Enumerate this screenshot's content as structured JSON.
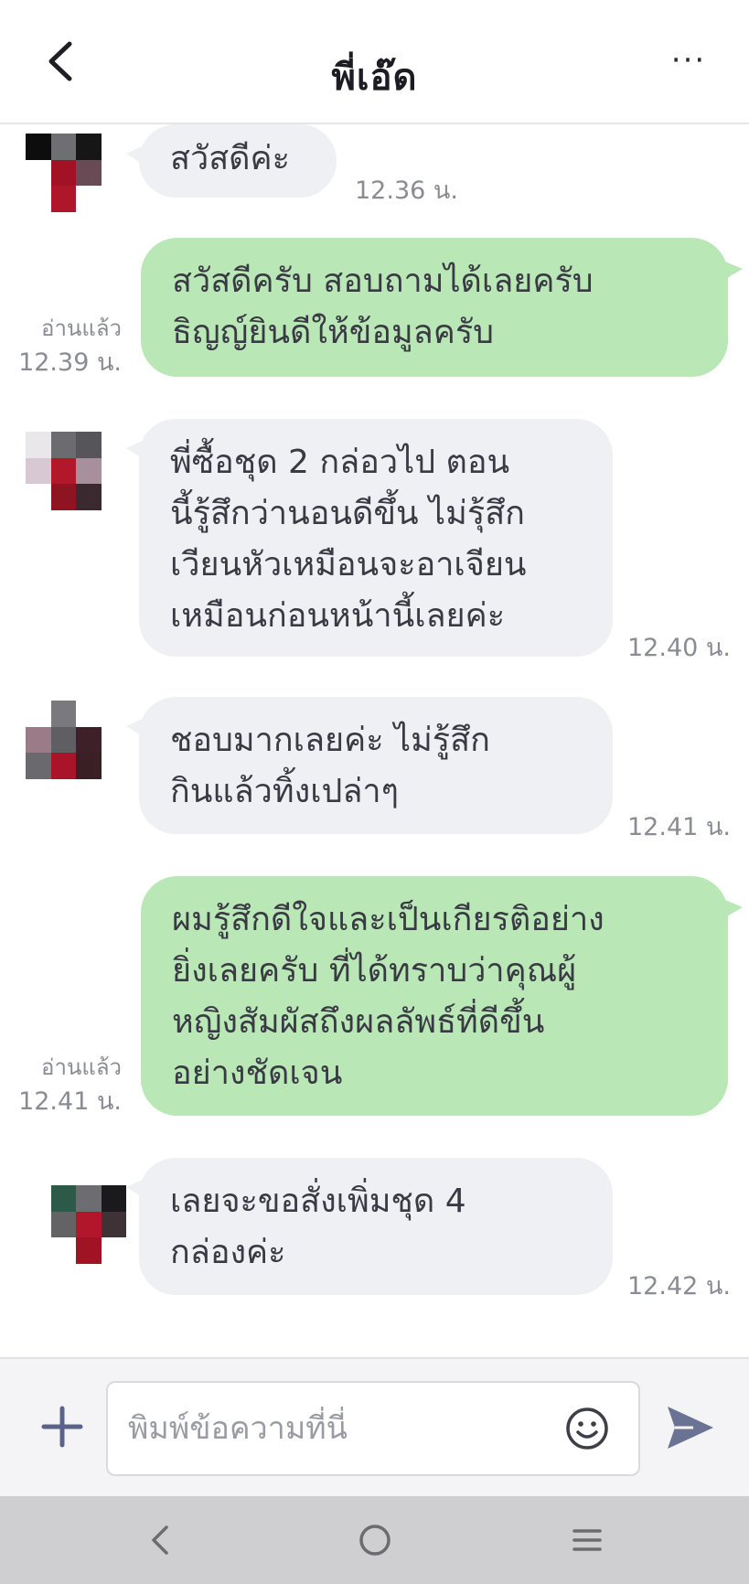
{
  "header": {
    "title": "พี่เอ๊ด",
    "back_icon": "chevron-left-icon",
    "more_icon": "more-dots-icon",
    "more_label": "···"
  },
  "messages": [
    {
      "side": "in",
      "lines": [
        "สวัสดีค่ะ"
      ],
      "time": "12.36 น."
    },
    {
      "side": "out",
      "lines": [
        "สวัสดีครับ สอบถามได้เลยครับ",
        "ธิญญ์ยินดีให้ข้อมูลครับ"
      ],
      "read": "อ่านแล้ว",
      "time": "12.39 น."
    },
    {
      "side": "in",
      "lines": [
        "พี่ซื้อชุด 2 กล่อวไป ตอน",
        "นี้รู้สึกว่านอนดีขึ้น ไม่รุ้สึก",
        "เวียนหัวเหมือนจะอาเจียน",
        "เหมือนก่อนหน้านี้เลยค่ะ"
      ],
      "time": "12.40 น."
    },
    {
      "side": "in",
      "lines": [
        "ชอบมากเลยค่ะ ไม่รู้สึก",
        "กินแล้วทิ้งเปล่าๆ"
      ],
      "time": "12.41 น."
    },
    {
      "side": "out",
      "lines": [
        "ผมรู้สึกดีใจและเป็นเกียรติอย่าง",
        "ยิ่งเลยครับ ที่ได้ทราบว่าคุณผู้",
        "หญิงสัมผัสถึงผลลัพธ์ที่ดีขึ้น",
        "อย่างชัดเจน"
      ],
      "read": "อ่านแล้ว",
      "time": "12.41 น."
    },
    {
      "side": "in",
      "lines": [
        "เลยจะขอสั่งเพิ่มชุด 4",
        "กล่องค่ะ"
      ],
      "time": "12.42 น."
    }
  ],
  "input": {
    "placeholder": "พิมพ์ข้อความที่นี่",
    "plus_icon": "plus-icon",
    "emoji_icon": "emoji-icon",
    "send_icon": "send-icon"
  },
  "nav": {
    "back_icon": "nav-back-icon",
    "home_icon": "nav-home-icon",
    "menu_icon": "nav-menu-icon"
  },
  "colors": {
    "incoming_bubble": "#eff0f3",
    "outgoing_bubble": "#b9e8b6",
    "timestamp": "#8a8c94",
    "send_accent": "#6b7394"
  }
}
